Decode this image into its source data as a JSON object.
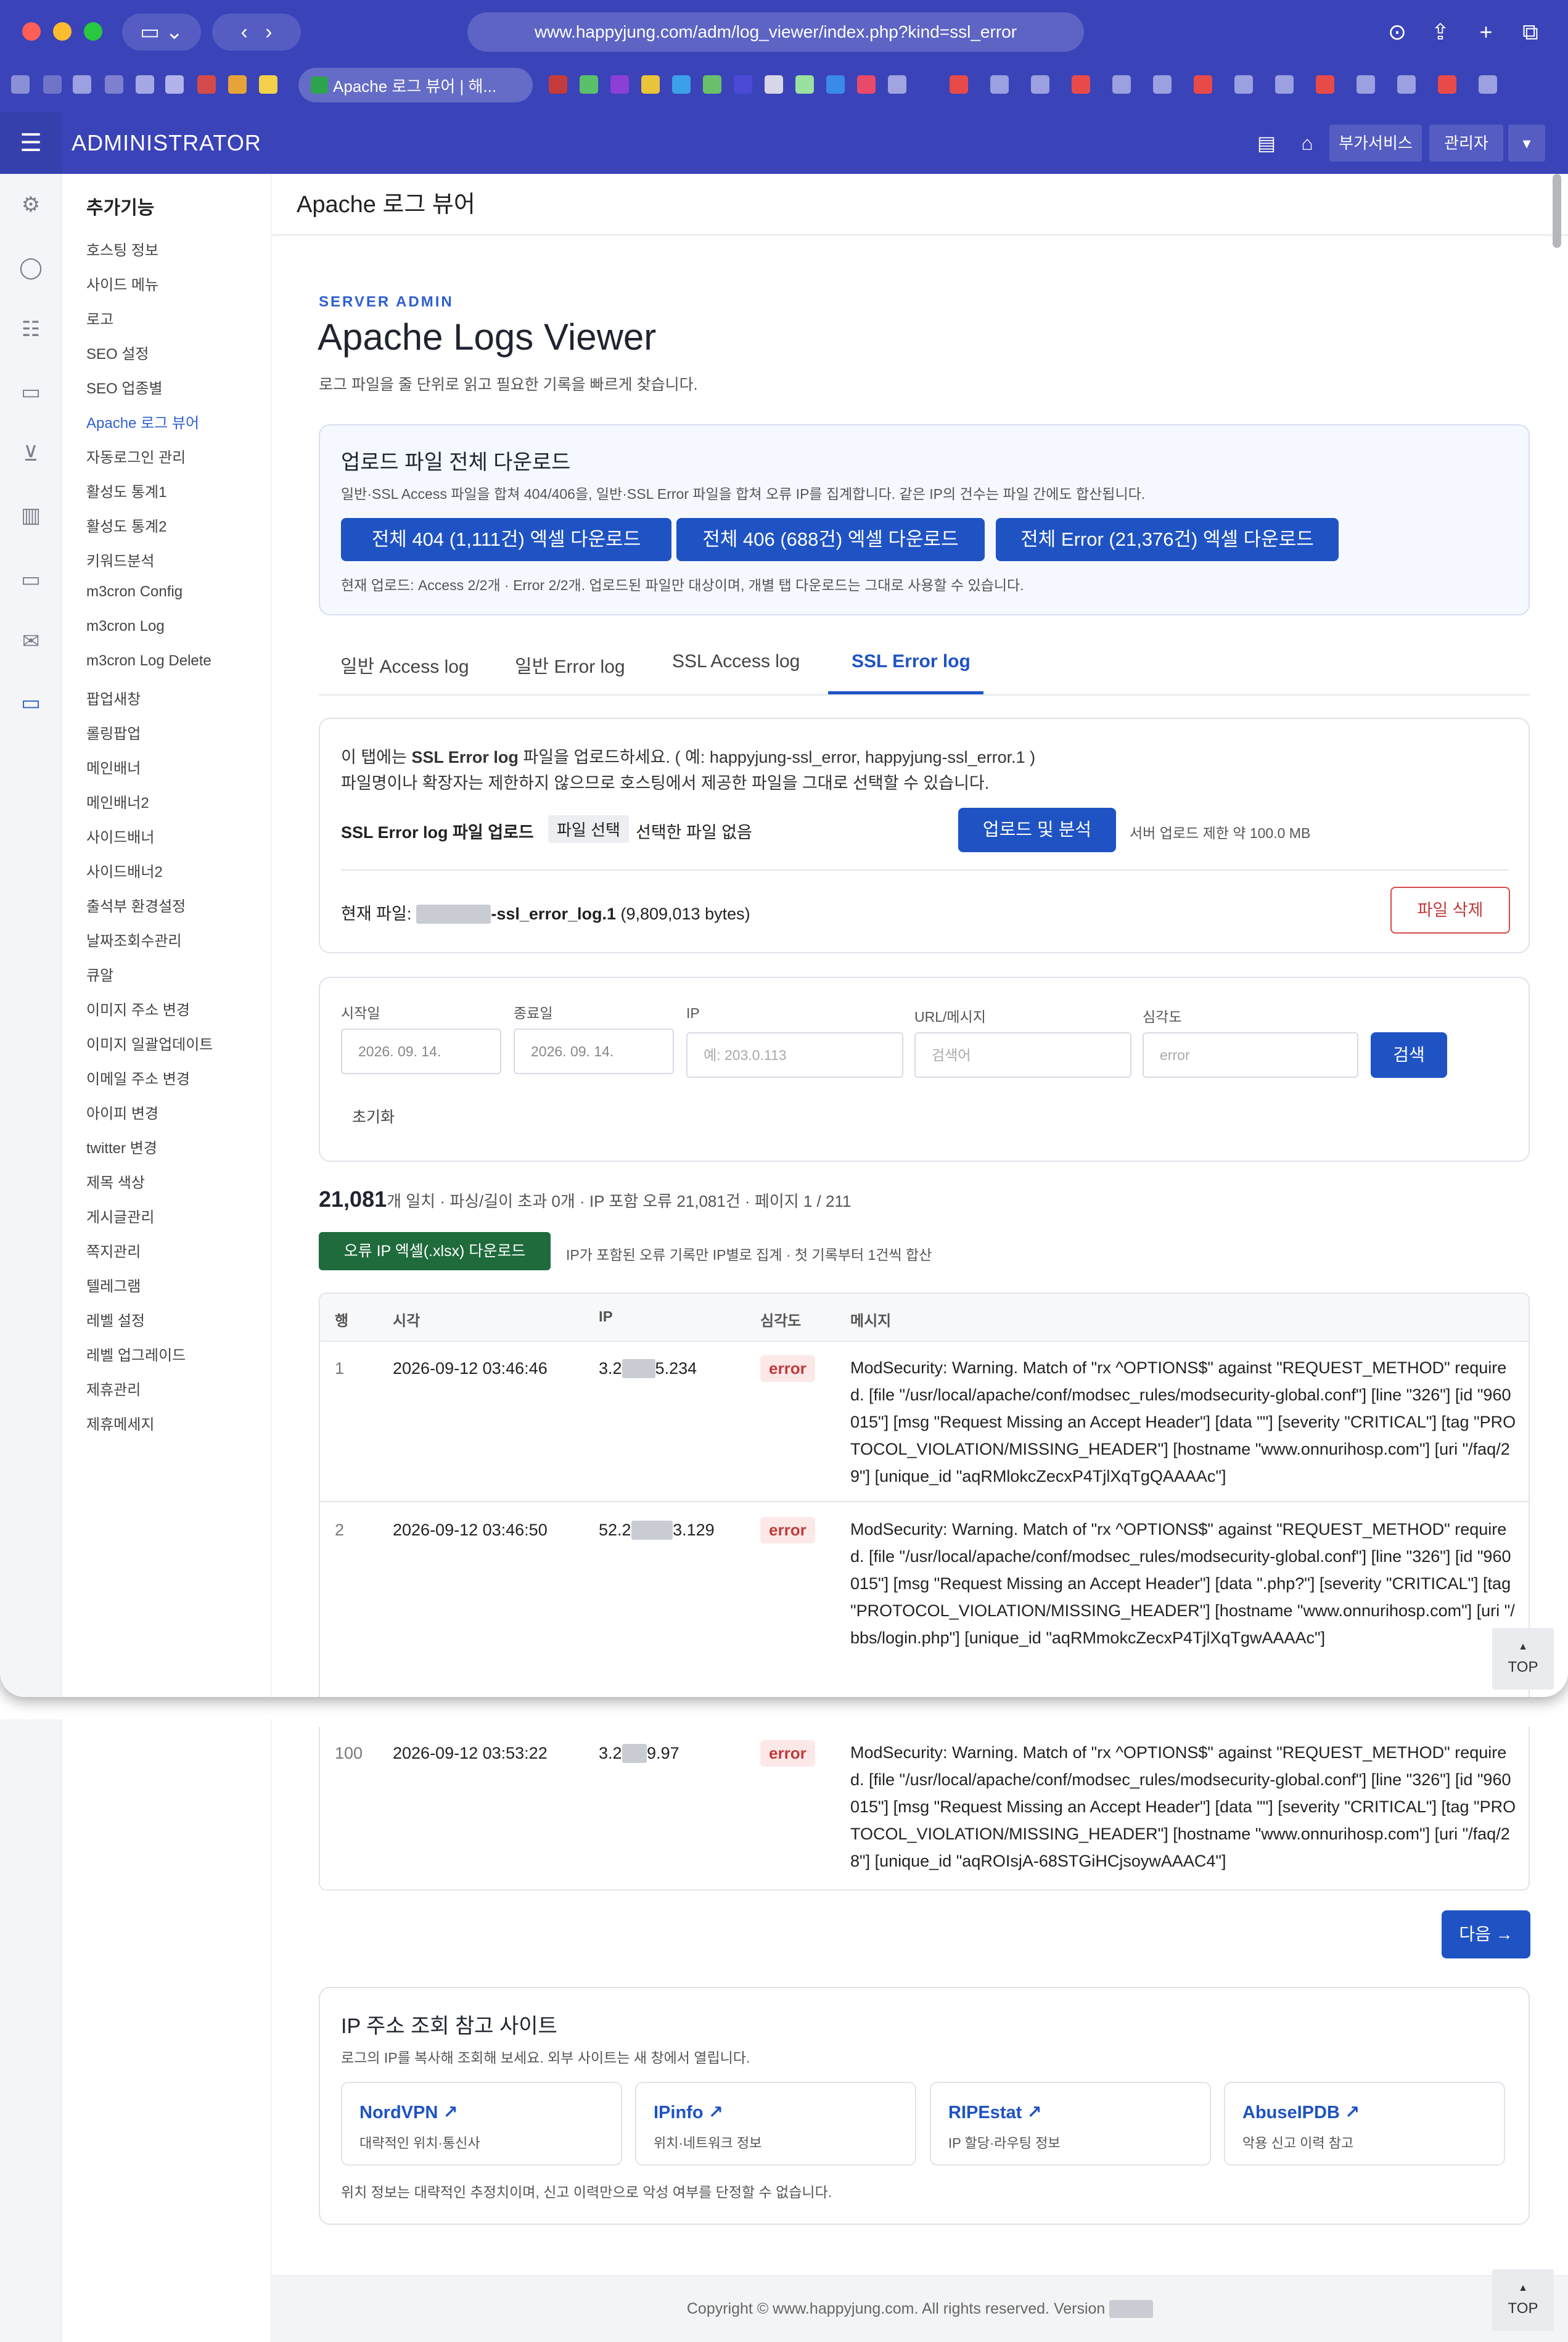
{
  "browser": {
    "url": "www.happyjung.com/adm/log_viewer/index.php?kind=ssl_error",
    "active_tab_title": "Apache 로그 뷰어 | 해..."
  },
  "header": {
    "brand": "ADMINISTRATOR",
    "service_button": "부가서비스",
    "admin_button": "관리자"
  },
  "sidebar": {
    "section_title": "추가기능",
    "items": [
      "호스팅 정보",
      "사이드 메뉴",
      "로고",
      "SEO 설정",
      "SEO 업종별",
      "Apache 로그 뷰어",
      "자동로그인 관리",
      "활성도 통계1",
      "활성도 통계2",
      "키워드분석",
      "m3cron Config",
      "m3cron Log",
      "m3cron Log Delete",
      "팝업새창",
      "롤링팝업",
      "메인배너",
      "메인배너2",
      "사이드배너",
      "사이드배너2",
      "출석부 환경설정",
      "날짜조회수관리",
      "큐알",
      "이미지 주소 변경",
      "이미지 일괄업데이트",
      "이메일 주소 변경",
      "아이피 변경",
      "twitter 변경",
      "제목 색상",
      "게시글관리",
      "쪽지관리",
      "텔레그램",
      "레벨 설정",
      "레벨 업그레이드",
      "제휴관리",
      "제휴메세지"
    ],
    "active_index": 5
  },
  "page": {
    "title": "Apache 로그 뷰어",
    "eyebrow": "SERVER ADMIN",
    "heading": "Apache Logs Viewer",
    "subtitle": "로그 파일을 줄 단위로 읽고 필요한 기록을 빠르게 찾습니다."
  },
  "download_card": {
    "title": "업로드 파일 전체 다운로드",
    "desc": "일반·SSL Access 파일을 합쳐 404/406을, 일반·SSL Error 파일을 합쳐 오류 IP를 집계합니다. 같은 IP의 건수는 파일 간에도 합산됩니다.",
    "btn_404": "전체 404 (1,111건) 엑셀 다운로드",
    "btn_406": "전체 406 (688건) 엑셀 다운로드",
    "btn_error": "전체 Error (21,376건) 엑셀 다운로드",
    "note": "현재 업로드: Access 2/2개 · Error 2/2개. 업로드된 파일만 대상이며, 개별 탭 다운로드는 그대로 사용할 수 있습니다."
  },
  "tabs": [
    "일반 Access log",
    "일반 Error log",
    "SSL Access log",
    "SSL Error log"
  ],
  "upload_card": {
    "line1_prefix": "이 탭에는 ",
    "line1_bold": "SSL Error log",
    "line1_suffix": " 파일을 업로드하세요. ( 예: happyjung-ssl_error, happyjung-ssl_error.1 )",
    "line2": "파일명이나 확장자는 제한하지 않으므로 호스팅에서 제공한 파일을 그대로 선택할 수 있습니다.",
    "upload_label": "SSL Error log 파일 업로드",
    "file_button": "파일 선택",
    "no_file": "선택한 파일 없음",
    "upload_button": "업로드 및 분석",
    "limit": "서버 업로드 제한 약 100.0 MB",
    "current_label": "현재 파일: ",
    "current_file": "-ssl_error_log.1",
    "current_size": " (9,809,013 bytes)",
    "delete_button": "파일 삭제"
  },
  "filters": {
    "start_label": "시작일",
    "start_value": "2026. 09. 14.",
    "end_label": "종료일",
    "end_value": "2026. 09. 14.",
    "ip_label": "IP",
    "ip_placeholder": "예: 203.0.113",
    "url_label": "URL/메시지",
    "url_placeholder": "검색어",
    "severity_label": "심각도",
    "severity_placeholder": "error",
    "search_button": "검색",
    "reset": "초기화"
  },
  "results": {
    "count": "21,081",
    "summary": "개 일치 · 파싱/길이 초과 0개 · IP 포함 오류 21,081건 · 페이지 1 / 211",
    "excel_button": "오류 IP 엑셀(.xlsx) 다운로드",
    "excel_note": "IP가 포함된 오류 기록만 IP별로 집계 · 첫 기록부터 1건씩 합산"
  },
  "table": {
    "headers": [
      "행",
      "시각",
      "IP",
      "심각도",
      "메시지"
    ],
    "rows": [
      {
        "num": "1",
        "time": "2026-09-12 03:46:46",
        "ip_a": "3.2",
        "ip_b": "5.234",
        "sev": "error",
        "msg": "ModSecurity: Warning. Match of \"rx ^OPTIONS$\" against \"REQUEST_METHOD\" required. [file \"/usr/local/apache/conf/modsec_rules/modsecurity-global.conf\"] [line \"326\"] [id \"960015\"] [msg \"Request Missing an Accept Header\"] [data \"\"] [severity \"CRITICAL\"] [tag \"PROTOCOL_VIOLATION/MISSING_HEADER\"] [hostname \"www.onnurihosp.com\"] [uri \"/faq/29\"] [unique_id \"aqRMlokcZecxP4TjlXqTgQAAAAc\"]"
      },
      {
        "num": "2",
        "time": "2026-09-12 03:46:50",
        "ip_a": "52.2",
        "ip_b": "3.129",
        "sev": "error",
        "msg": "ModSecurity: Warning. Match of \"rx ^OPTIONS$\" against \"REQUEST_METHOD\" required. [file \"/usr/local/apache/conf/modsec_rules/modsecurity-global.conf\"] [line \"326\"] [id \"960015\"] [msg \"Request Missing an Accept Header\"] [data \".php?\"] [severity \"CRITICAL\"] [tag \"PROTOCOL_VIOLATION/MISSING_HEADER\"] [hostname \"www.onnurihosp.com\"] [uri \"/bbs/login.php\"] [unique_id \"aqRMmokcZecxP4TjlXqTgwAAAAc\"]"
      },
      {
        "num": "100",
        "time": "2026-09-12 03:53:22",
        "ip_a": "3.2",
        "ip_b": "9.97",
        "sev": "error",
        "msg": "ModSecurity: Warning. Match of \"rx ^OPTIONS$\" against \"REQUEST_METHOD\" required. [file \"/usr/local/apache/conf/modsec_rules/modsecurity-global.conf\"] [line \"326\"] [id \"960015\"] [msg \"Request Missing an Accept Header\"] [data \"\"] [severity \"CRITICAL\"] [tag \"PROTOCOL_VIOLATION/MISSING_HEADER\"] [hostname \"www.onnurihosp.com\"] [uri \"/faq/28\"] [unique_id \"aqROIsjA-68STGiHCjsoywAAAC4\"]"
      }
    ]
  },
  "next_button": "다음 →",
  "top_label": "TOP",
  "ip_sites": {
    "title": "IP 주소 조회 참고 사이트",
    "desc": "로그의 IP를 복사해 조회해 보세요. 외부 사이트는 새 창에서 열립니다.",
    "sites": [
      {
        "name": "NordVPN ↗",
        "desc": "대략적인 위치·통신사"
      },
      {
        "name": "IPinfo ↗",
        "desc": "위치·네트워크 정보"
      },
      {
        "name": "RIPEstat ↗",
        "desc": "IP 할당·라우팅 정보"
      },
      {
        "name": "AbuseIPDB ↗",
        "desc": "악용 신고 이력 참고"
      }
    ],
    "note": "위치 정보는 대략적인 추정치이며, 신고 이력만으로 악성 여부를 단정할 수 없습니다."
  },
  "footer": {
    "text": "Copyright © www.happyjung.com. All rights reserved. Version "
  },
  "colors": {
    "header": "#3a43b8",
    "primary": "#1f53c4",
    "excel_green": "#1f6b3c",
    "error_red": "#c13b3b"
  }
}
